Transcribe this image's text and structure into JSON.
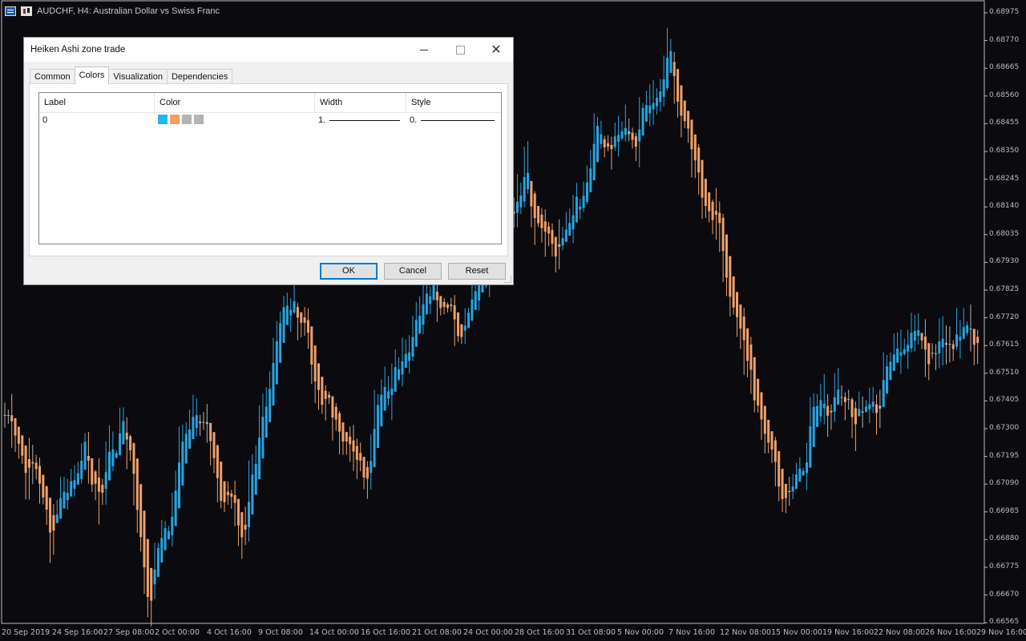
{
  "chart_header": {
    "symbol_text": "AUDCHF, H4:  Australian Dollar vs Swiss  Franc"
  },
  "price_axis": [
    "0.68975",
    "0.68770",
    "0.68665",
    "0.68560",
    "0.68455",
    "0.68350",
    "0.68245",
    "0.68140",
    "0.68035",
    "0.67930",
    "0.67825",
    "0.67720",
    "0.67615",
    "0.67510",
    "0.67405",
    "0.67300",
    "0.67195",
    "0.67090",
    "0.66985",
    "0.66880",
    "0.66775",
    "0.66670",
    "0.66565"
  ],
  "time_axis": [
    "20 Sep 2019",
    "24 Sep 16:00",
    "27 Sep 08:00",
    "2 Oct 00:00",
    "4 Oct 16:00",
    "9 Oct 08:00",
    "14 Oct 00:00",
    "16 Oct 16:00",
    "21 Oct 08:00",
    "24 Oct 00:00",
    "28 Oct 16:00",
    "31 Oct 08:00",
    "5 Nov 00:00",
    "7 Nov 16:00",
    "12 Nov 08:00",
    "15 Nov 00:00",
    "19 Nov 16:00",
    "22 Nov 08:00",
    "26 Nov 16:00",
    "29 Nov 16:00"
  ],
  "colors": {
    "background": "#0b0b0f",
    "bull": "#29a3e0",
    "bear": "#f0a06a",
    "neutral": "#b3b3b3"
  },
  "chart_data": {
    "type": "candlestick",
    "symbol": "AUDCHF",
    "timeframe": "H4",
    "ylim": [
      0.6651,
      0.6902
    ],
    "anchors": [
      {
        "x": "20 Sep 2019",
        "close": 0.6735
      },
      {
        "x": "23 Sep",
        "close": 0.6715
      },
      {
        "x": "24 Sep 16:00",
        "close": 0.669
      },
      {
        "x": "26 Sep",
        "close": 0.6718
      },
      {
        "x": "27 Sep 08:00",
        "close": 0.6705
      },
      {
        "x": "30 Sep",
        "close": 0.6735
      },
      {
        "x": "2 Oct 00:00",
        "close": 0.6662
      },
      {
        "x": "3 Oct",
        "close": 0.67
      },
      {
        "x": "4 Oct 16:00",
        "close": 0.6745
      },
      {
        "x": "7 Oct",
        "close": 0.6705
      },
      {
        "x": "9 Oct 08:00",
        "close": 0.669
      },
      {
        "x": "10 Oct",
        "close": 0.674
      },
      {
        "x": "11 Oct",
        "close": 0.679
      },
      {
        "x": "14 Oct 00:00",
        "close": 0.675
      },
      {
        "x": "15 Oct",
        "close": 0.673
      },
      {
        "x": "16 Oct 16:00",
        "close": 0.671
      },
      {
        "x": "17 Oct",
        "close": 0.6745
      },
      {
        "x": "21 Oct 08:00",
        "close": 0.6765
      },
      {
        "x": "22 Oct",
        "close": 0.679
      },
      {
        "x": "24 Oct 00:00",
        "close": 0.677
      },
      {
        "x": "25 Oct",
        "close": 0.679
      },
      {
        "x": "28 Oct 16:00",
        "close": 0.6815
      },
      {
        "x": "29 Oct",
        "close": 0.683
      },
      {
        "x": "31 Oct 08:00",
        "close": 0.68
      },
      {
        "x": "1 Nov",
        "close": 0.6815
      },
      {
        "x": "4 Nov",
        "close": 0.6845
      },
      {
        "x": "5 Nov 00:00",
        "close": 0.6842
      },
      {
        "x": "6 Nov",
        "close": 0.6855
      },
      {
        "x": "7 Nov 16:00",
        "close": 0.6878
      },
      {
        "x": "8 Nov",
        "close": 0.6835
      },
      {
        "x": "11 Nov",
        "close": 0.681
      },
      {
        "x": "12 Nov 08:00",
        "close": 0.6765
      },
      {
        "x": "13 Nov",
        "close": 0.6725
      },
      {
        "x": "15 Nov 00:00",
        "close": 0.67
      },
      {
        "x": "18 Nov",
        "close": 0.6735
      },
      {
        "x": "19 Nov 16:00",
        "close": 0.6745
      },
      {
        "x": "20 Nov",
        "close": 0.6735
      },
      {
        "x": "22 Nov 08:00",
        "close": 0.6745
      },
      {
        "x": "25 Nov",
        "close": 0.677
      },
      {
        "x": "26 Nov 16:00",
        "close": 0.676
      },
      {
        "x": "28 Nov",
        "close": 0.6765
      },
      {
        "x": "29 Nov 16:00",
        "close": 0.677
      }
    ]
  },
  "dialog": {
    "title": "Heiken Ashi zone trade",
    "tabs": [
      {
        "label": "Common",
        "active": false
      },
      {
        "label": "Colors",
        "active": true
      },
      {
        "label": "Visualization",
        "active": false
      },
      {
        "label": "Dependencies",
        "active": false
      }
    ],
    "table": {
      "columns": [
        "Label",
        "Color",
        "Width",
        "Style"
      ],
      "rows": [
        {
          "label": "0",
          "swatches": [
            "#1fb5f0",
            "#f0a060",
            "#b4b4b4",
            "#b4b4b4"
          ],
          "width": "1.",
          "style": "0."
        }
      ]
    },
    "buttons": {
      "ok": "OK",
      "cancel": "Cancel",
      "reset": "Reset"
    }
  }
}
